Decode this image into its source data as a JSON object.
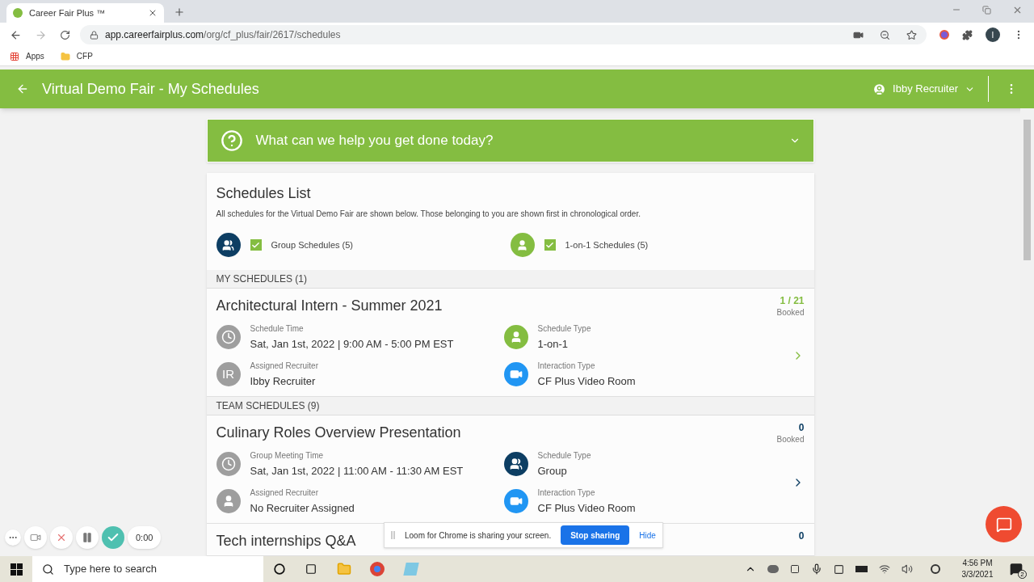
{
  "browser": {
    "tab_title": "Career Fair Plus ™",
    "url_host": "app.careerfairplus.com",
    "url_path": "/org/cf_plus/fair/2617/schedules",
    "bookmarks": [
      "Apps",
      "CFP"
    ],
    "profile_initial": "I"
  },
  "header": {
    "title": "Virtual Demo Fair - My Schedules",
    "user": "Ibby Recruiter"
  },
  "help_banner": {
    "text": "What can we help you get done today?",
    "expanded": false
  },
  "schedules_list": {
    "title": "Schedules List",
    "description": "All schedules for the Virtual Demo Fair are shown below. Those belonging to you are shown first in chronological order.",
    "filters": [
      {
        "kind": "group",
        "label": "Group Schedules (5)",
        "checked": true
      },
      {
        "kind": "one_on_one",
        "label": "1-on-1 Schedules (5)",
        "checked": true
      }
    ]
  },
  "sections": [
    {
      "heading": "MY SCHEDULES (1)",
      "schedules": [
        {
          "title": "Architectural Intern - Summer 2021",
          "kind": "one_on_one",
          "booked": "1 / 21",
          "booked_label": "Booked",
          "fields": [
            {
              "kind": "time",
              "label": "Schedule Time",
              "value": "Sat, Jan 1st, 2022 | 9:00 AM - 5:00 PM EST"
            },
            {
              "kind": "type",
              "label": "Schedule Type",
              "value": "1-on-1"
            },
            {
              "kind": "recruiter",
              "label": "Assigned Recruiter",
              "value": "Ibby Recruiter",
              "initials": "IR"
            },
            {
              "kind": "interaction",
              "label": "Interaction Type",
              "value": "CF Plus Video Room"
            }
          ]
        }
      ]
    },
    {
      "heading": "TEAM SCHEDULES (9)",
      "schedules": [
        {
          "title": "Culinary Roles Overview Presentation",
          "kind": "group",
          "booked": "0",
          "booked_label": "Booked",
          "fields": [
            {
              "kind": "time",
              "label": "Group Meeting Time",
              "value": "Sat, Jan 1st, 2022 | 11:00 AM - 11:30 AM EST"
            },
            {
              "kind": "type",
              "label": "Schedule Type",
              "value": "Group"
            },
            {
              "kind": "recruiter",
              "label": "Assigned Recruiter",
              "value": "No Recruiter Assigned"
            },
            {
              "kind": "interaction",
              "label": "Interaction Type",
              "value": "CF Plus Video Room"
            }
          ]
        },
        {
          "title": "Tech internships Q&A",
          "kind": "group",
          "booked": "0"
        }
      ]
    }
  ],
  "loom_controls": {
    "timer": "0:00"
  },
  "loom_banner": {
    "text": "Loom for Chrome is sharing your screen.",
    "stop_button": "Stop sharing",
    "hide_link": "Hide"
  },
  "taskbar": {
    "search_placeholder": "Type here to search",
    "time": "4:56 PM",
    "date": "3/3/2021",
    "notifications": "2"
  }
}
